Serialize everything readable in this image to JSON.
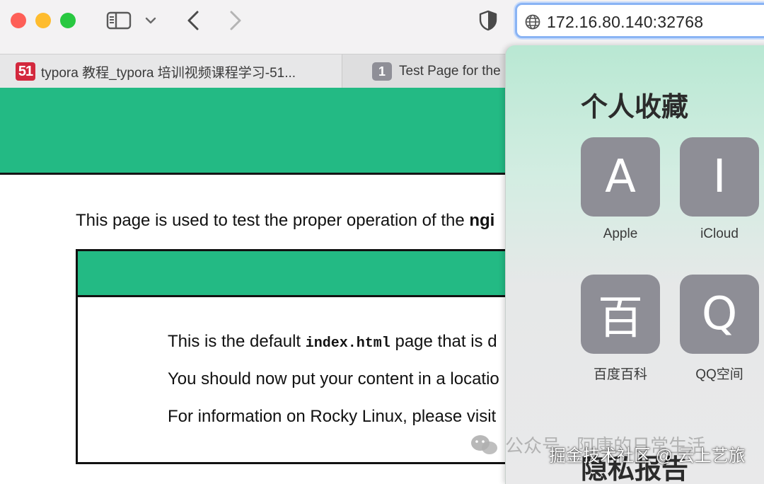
{
  "browser": {
    "address": "172.16.80.140:32768",
    "tabs": [
      {
        "favicon": "51",
        "title": "typora 教程_typora 培训视频课程学习-51..."
      },
      {
        "favicon": "1",
        "title": "Test Page for the"
      }
    ],
    "icons": [
      "sidebar-icon",
      "chevron-down-icon",
      "back-icon",
      "forward-icon",
      "shield-icon",
      "globe-icon"
    ]
  },
  "page": {
    "intro_prefix": "This page is used to test the proper operation of the ",
    "intro_bold": "ngi",
    "line1_prefix": "This is the default ",
    "line1_code": "index.html",
    "line1_suffix": " page that is d",
    "line2": "You should now put your content in a locatio",
    "line3": "For information on Rocky Linux, please visit"
  },
  "favorites": {
    "title": "个人收藏",
    "items": [
      {
        "letter": "A",
        "name": "Apple"
      },
      {
        "letter": "I",
        "name": "iCloud"
      },
      {
        "letter": "百",
        "name": "百度百科"
      },
      {
        "letter": "Q",
        "name": "QQ空间"
      }
    ],
    "privacy_title": "隐私报告"
  },
  "watermarks": {
    "wechat": "公众号 · 阿康的日常生活",
    "juejin": "掘金技术社区 @ 云上艺旅"
  },
  "colors": {
    "accent_green": "#23ba84",
    "tile_gray": "#8e8e96",
    "address_focus": "#8ab4f4"
  }
}
